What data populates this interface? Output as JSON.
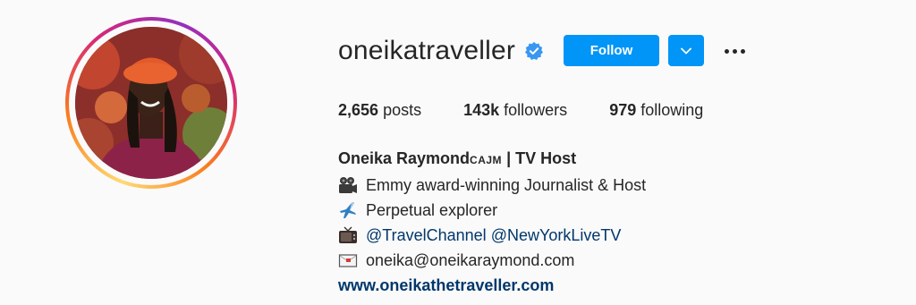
{
  "profile": {
    "username": "oneikatraveller",
    "verified": true,
    "follow_label": "Follow",
    "accent_color": "#0095f6"
  },
  "stats": {
    "posts_count": "2,656",
    "posts_label": "posts",
    "followers_count": "143k",
    "followers_label": "followers",
    "following_count": "979",
    "following_label": "following"
  },
  "bio": {
    "name": "Oneika Raymond",
    "credential": "CAJM",
    "name_suffix": " | TV Host",
    "lines": [
      {
        "icon": "film-camera-icon",
        "text": "Emmy award-winning Journalist & Host"
      },
      {
        "icon": "airplane-icon",
        "text": "Perpetual explorer"
      },
      {
        "icon": "television-icon",
        "mention1": "@TravelChannel",
        "mention2": "@NewYorkLiveTV"
      },
      {
        "icon": "envelope-icon",
        "text": "oneika@oneikaraymond.com"
      }
    ],
    "website": "www.oneikathetraveller.com"
  }
}
